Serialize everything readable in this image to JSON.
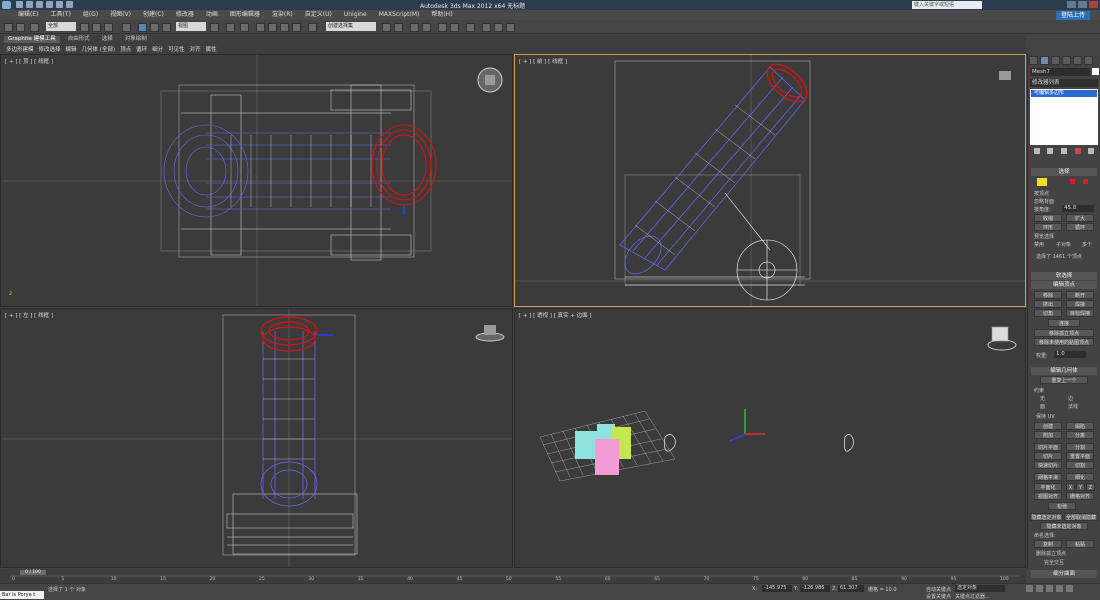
{
  "window": {
    "title": "Autodesk 3ds Max  2012 x64    无标题",
    "search_placeholder": "键入关键字或短语",
    "sign_in": "登陆上传"
  },
  "menu": [
    "编辑(E)",
    "工具(T)",
    "组(G)",
    "视图(V)",
    "创建(C)",
    "修改器",
    "动画",
    "图形编辑器",
    "渲染(R)",
    "自定义(U)",
    "Unigine",
    "MAXScript(M)",
    "帮助(H)"
  ],
  "toolbar": {
    "selection_filter": "全部",
    "ref_coord": "视图",
    "named_selection": "创建选择集"
  },
  "ribbon": {
    "tabs": [
      "Graphite 建模工具",
      "自由形式",
      "选择",
      "对象绘制"
    ],
    "sub": [
      "多边形建模",
      "修改选择",
      "编辑",
      "几何体 (全部)",
      "顶点",
      "循环",
      "细分",
      "可见性",
      "对齐",
      "属性"
    ]
  },
  "viewports": {
    "top": "[ + ] [ 顶 ] [ 线框 ]",
    "front": "[ + ] [ 前 ] [ 线框 ]",
    "left": "[ + ] [ 左 ] [ 线框 ]",
    "persp": "[ + ] [ 透视 ] [ 真实 + 边面 ]"
  },
  "command_panel": {
    "object_name": "Mesh7",
    "modifier_list": "修改器列表",
    "stack_item": "可编辑多边形",
    "selection_header": "选择",
    "by_vertex": "按顶点",
    "ignore_backfacing": "忽略背面",
    "by_angle": "按角度:",
    "angle_value": "45.0",
    "shrink": "收缩",
    "grow": "扩大",
    "ring": "环形",
    "loop": "循环",
    "preview_selection": "预览选择",
    "disabled": "禁用",
    "subobject": "子对象",
    "multi": "多个",
    "selected_count": "选择了 1461 个顶点",
    "soft_selection": "软选择",
    "edit_vertices_header": "编辑顶点",
    "remove": "移除",
    "break": "断开",
    "extrude": "挤出",
    "weld": "焊接",
    "chamfer": "切角",
    "target_weld": "目标焊接",
    "connect": "连接",
    "remove_isolated": "移除孤立顶点",
    "remove_unused_map": "移除未使用的贴图顶点",
    "weight_label": "权重:",
    "weight_value": "1.0",
    "edit_geometry_header": "编辑几何体",
    "repeat_last": "重复上一个",
    "constraints": "约束",
    "none": "无",
    "edge": "边",
    "face": "面",
    "normal": "法线",
    "preserve_uvs": "保持 UV",
    "create": "创建",
    "collapse": "塌陷",
    "attach": "附加",
    "detach": "分离",
    "slice_plane": "切片平面",
    "split": "分割",
    "slice": "切片",
    "reset_plane": "重置平面",
    "quickslice": "快速切片",
    "cut": "切割",
    "meshsmooth": "网格平滑",
    "tessellate": "细化",
    "make_planar": "平面化",
    "x": "X",
    "y": "Y",
    "z": "Z",
    "view_align": "视图对齐",
    "grid_align": "栅格对齐",
    "relax": "松弛",
    "hide_selected": "隐藏选定对象",
    "unhide_all": "全部取消隐藏",
    "hide_unselected": "隐藏未选定对象",
    "named_selections": "命名选择:",
    "copy": "复制",
    "paste": "粘贴",
    "delete_isolated": "删除孤立顶点",
    "full_interactivity": "完全交互",
    "subdivision_header": "细分曲面"
  },
  "timeline": {
    "frame": "0 / 100",
    "ticks": [
      "0",
      "5",
      "10",
      "15",
      "20",
      "25",
      "30",
      "35",
      "40",
      "45",
      "50",
      "55",
      "60",
      "65",
      "70",
      "75",
      "80",
      "85",
      "90",
      "95",
      "100"
    ]
  },
  "status": {
    "script": "Bar is Porya t",
    "selection_info": "选择了 1 个 对象",
    "x_value": "-145.975",
    "y_value": "-126.986",
    "z_value": "61.307",
    "grid": "栅格 = 10.0",
    "auto_key": "自动关键点",
    "selected_label": "选定对象",
    "set_key": "设置关键点",
    "key_filters": "关键点过滤器..."
  },
  "colors": {
    "selected_verts": "#e01010",
    "wire_blue": "#5c5cff",
    "wire_white": "#ffffff",
    "active_border": "#c8a34a"
  }
}
